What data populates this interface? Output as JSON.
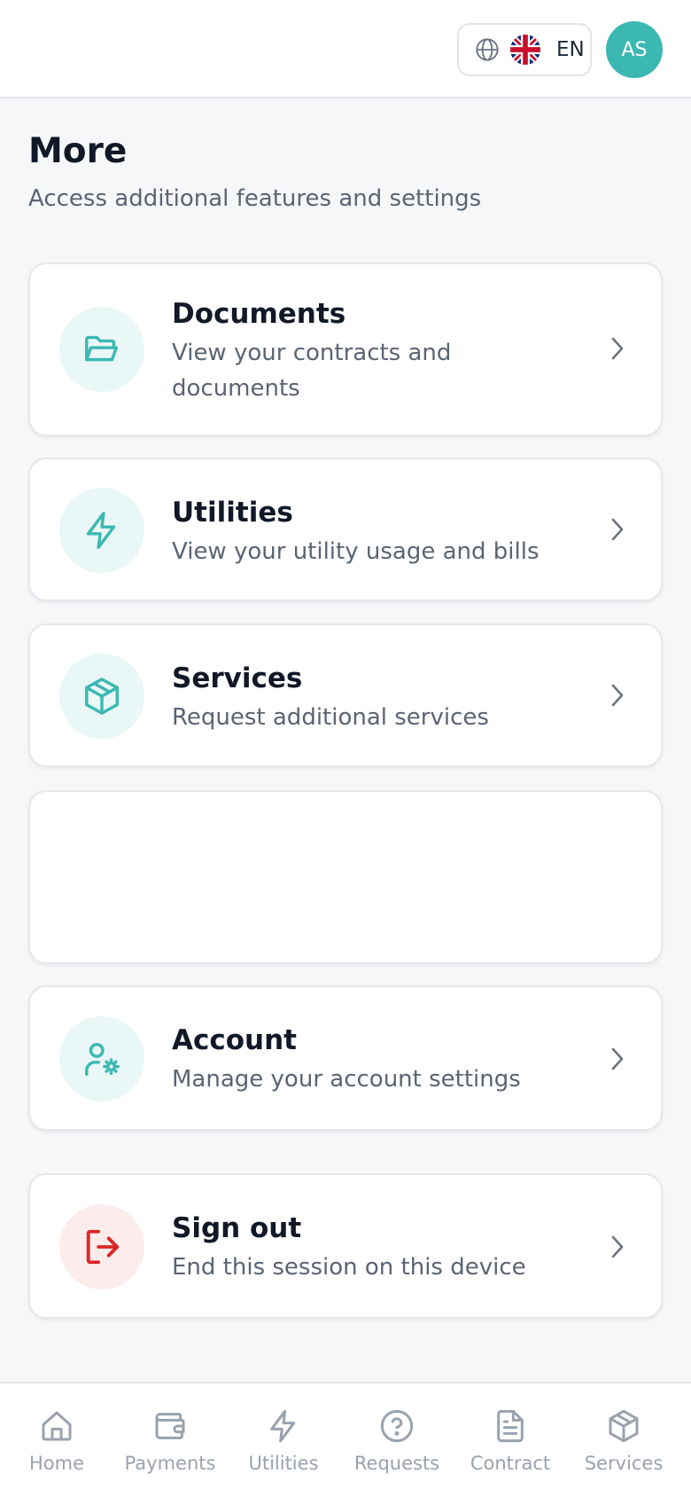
{
  "header": {
    "language_code": "EN",
    "avatar_initials": "AS"
  },
  "page": {
    "title": "More",
    "subtitle": "Access additional features and settings"
  },
  "cards": {
    "documents": {
      "title": "Documents",
      "desc": "View your contracts and documents",
      "icon": "folder-icon"
    },
    "utilities": {
      "title": "Utilities",
      "desc": "View your utility usage and bills",
      "icon": "lightning-icon"
    },
    "services": {
      "title": "Services",
      "desc": "Request additional services",
      "icon": "package-icon"
    },
    "account": {
      "title": "Account",
      "desc": "Manage your account settings",
      "icon": "user-settings-icon"
    },
    "signout": {
      "title": "Sign out",
      "desc": "End this session on this device",
      "icon": "logout-icon"
    }
  },
  "bottom_nav": {
    "home": "Home",
    "payments": "Payments",
    "utilities": "Utilities",
    "requests": "Requests",
    "contract": "Contract",
    "services": "Services"
  },
  "colors": {
    "accent": "#3cb8b2",
    "danger": "#dc2626",
    "muted": "#9aa2ad"
  }
}
